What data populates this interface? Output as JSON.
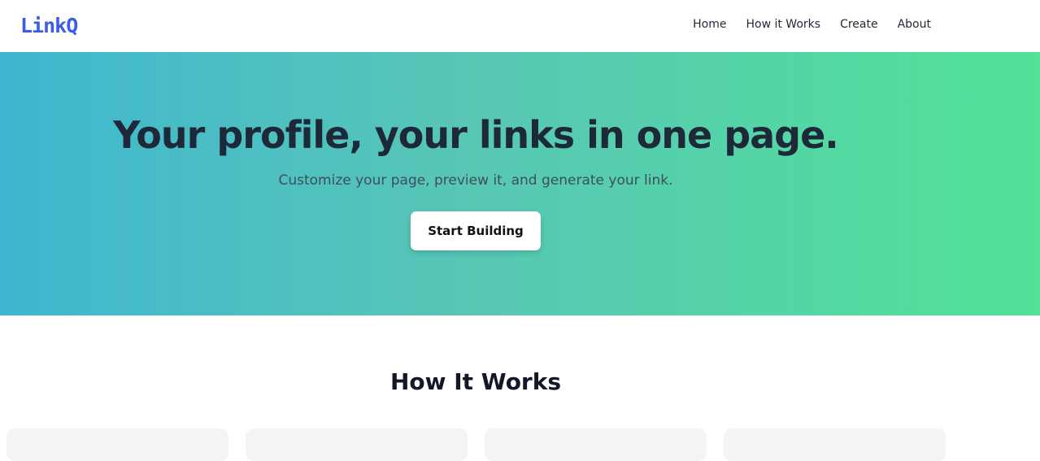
{
  "brand": {
    "logo_text": "LinkQ"
  },
  "nav": {
    "items": [
      {
        "label": "Home"
      },
      {
        "label": "How it Works"
      },
      {
        "label": "Create"
      },
      {
        "label": "About"
      }
    ]
  },
  "hero": {
    "title": "Your profile, your links in one page.",
    "subtitle": "Customize your page, preview it, and generate your link.",
    "cta_label": "Start Building"
  },
  "how_it_works": {
    "title": "How It Works"
  },
  "colors": {
    "brand_blue": "#3b5de7",
    "hero_gradient_start": "#3fb6d0",
    "hero_gradient_end": "#52e197",
    "heading_dark": "#1d2939"
  }
}
